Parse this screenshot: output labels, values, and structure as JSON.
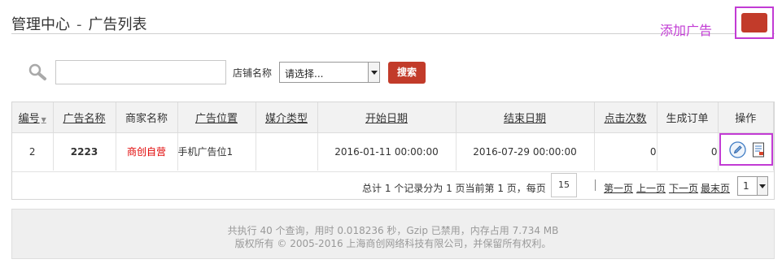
{
  "header": {
    "title": "管理中心",
    "separator": "-",
    "subtitle": "广告列表",
    "add_link": "添加广告"
  },
  "search": {
    "input_value": "",
    "shop_label": "店铺名称",
    "shop_select_value": "请选择...",
    "button_label": "搜索"
  },
  "table": {
    "columns": [
      "编号",
      "广告名称",
      "商家名称",
      "广告位置",
      "媒介类型",
      "开始日期",
      "结束日期",
      "点击次数",
      "生成订单",
      "操作"
    ],
    "rows": [
      {
        "id": "2",
        "ad_name": "2223",
        "merchant": "商创自营",
        "position": "手机广告位1",
        "media_type": "",
        "start_date": "2016-01-11 00:00:00",
        "end_date": "2016-07-29 00:00:00",
        "clicks": "0",
        "orders": "0"
      }
    ],
    "icons": {
      "edit": "edit-pencil-icon",
      "view": "view-orders-icon"
    }
  },
  "pager": {
    "summary": "总计 1 个记录分为 1 页当前第 1 页，每页",
    "per_page": "15",
    "first": "第一页",
    "prev": "上一页",
    "next": "下一页",
    "last": "最末页",
    "page_select": "1"
  },
  "footer": {
    "line1": "共执行 40 个查询，用时 0.018236 秒，Gzip 已禁用，内存占用 7.734 MB",
    "line2": "版权所有 © 2005-2016 上海商创网络科技有限公司，并保留所有权利。"
  },
  "colors": {
    "accent_red": "#c23b2a",
    "highlight_purple": "#c23bd4",
    "merchant_red": "#e00000"
  }
}
